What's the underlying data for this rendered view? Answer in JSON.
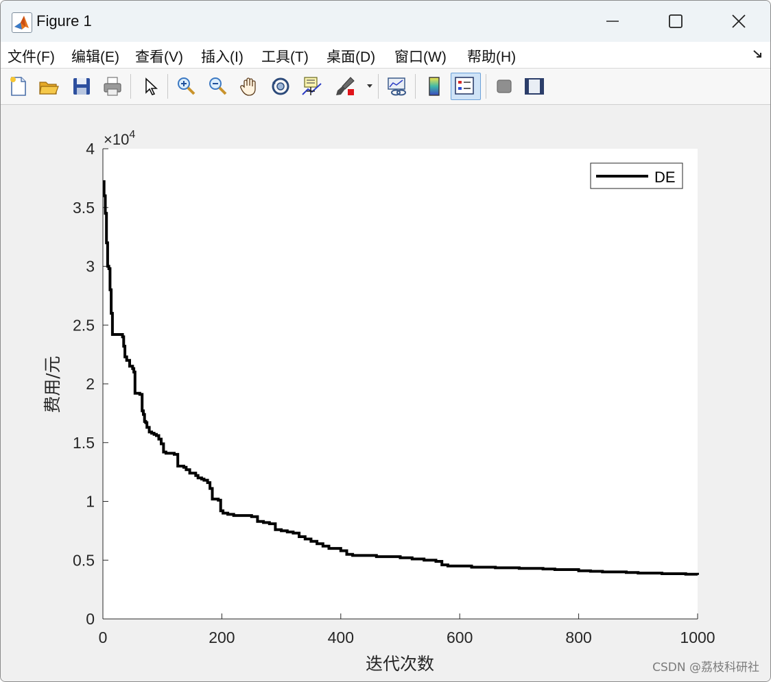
{
  "window": {
    "title": "Figure 1",
    "minimize_glyph": "—",
    "maximize_glyph": "□",
    "close_glyph": "✕"
  },
  "menu": {
    "items": [
      "文件(F)",
      "编辑(E)",
      "查看(V)",
      "插入(I)",
      "工具(T)",
      "桌面(D)",
      "窗口(W)",
      "帮助(H)"
    ]
  },
  "toolbar": {
    "icons": [
      "new-figure-icon",
      "open-file-icon",
      "save-icon",
      "print-icon",
      "pointer-icon",
      "zoom-in-icon",
      "zoom-out-icon",
      "pan-icon",
      "rotate-3d-icon",
      "data-cursor-icon",
      "brush-icon",
      "link-plot-icon",
      "colorbar-icon",
      "legend-icon",
      "hide-plot-tools-icon",
      "show-plot-tools-icon"
    ],
    "active": "legend-icon"
  },
  "chart_data": {
    "type": "line",
    "xlabel": "迭代次数",
    "ylabel": "费用/元",
    "xlim": [
      0,
      1000
    ],
    "ylim": [
      0,
      40000
    ],
    "x_ticks": [
      0,
      200,
      400,
      600,
      800,
      1000
    ],
    "x_tick_labels": [
      "0",
      "200",
      "400",
      "600",
      "800",
      "1000"
    ],
    "y_ticks": [
      0,
      5000,
      10000,
      15000,
      20000,
      25000,
      30000,
      35000,
      40000
    ],
    "y_tick_labels": [
      "0",
      "0.5",
      "1",
      "1.5",
      "2",
      "2.5",
      "3",
      "3.5",
      "4"
    ],
    "y_exponent_label": "×10",
    "y_exponent_power": "4",
    "grid": false,
    "legend_position": "top-right",
    "series": [
      {
        "name": "DE",
        "color": "#000000",
        "x": [
          0,
          2,
          4,
          6,
          8,
          10,
          12,
          14,
          16,
          20,
          25,
          30,
          33,
          35,
          37,
          40,
          45,
          50,
          52,
          54,
          56,
          58,
          62,
          66,
          68,
          70,
          72,
          74,
          78,
          82,
          86,
          90,
          94,
          98,
          102,
          106,
          110,
          114,
          120,
          126,
          130,
          136,
          140,
          146,
          150,
          156,
          160,
          166,
          170,
          176,
          180,
          184,
          188,
          194,
          198,
          202,
          210,
          220,
          240,
          250,
          260,
          270,
          280,
          290,
          300,
          310,
          320,
          330,
          340,
          350,
          360,
          370,
          380,
          400,
          410,
          420,
          440,
          460,
          480,
          500,
          520,
          540,
          560,
          570,
          580,
          600,
          620,
          640,
          660,
          680,
          700,
          720,
          740,
          760,
          780,
          800,
          820,
          840,
          860,
          880,
          900,
          920,
          940,
          960,
          980,
          1000
        ],
        "y": [
          37200,
          36000,
          34500,
          32000,
          30000,
          29800,
          28000,
          26000,
          24200,
          24200,
          24200,
          24200,
          24000,
          23200,
          22300,
          22000,
          21500,
          21300,
          21000,
          19200,
          19200,
          19200,
          19100,
          17700,
          17400,
          16800,
          16700,
          16300,
          15900,
          15800,
          15700,
          15600,
          15300,
          14900,
          14200,
          14100,
          14100,
          14100,
          14000,
          13000,
          13000,
          12900,
          12700,
          12400,
          12400,
          12200,
          12000,
          11900,
          11800,
          11600,
          11100,
          10200,
          10200,
          10100,
          9200,
          9000,
          8900,
          8800,
          8800,
          8700,
          8300,
          8200,
          8100,
          7600,
          7500,
          7400,
          7300,
          7000,
          6800,
          6600,
          6400,
          6200,
          6000,
          5800,
          5500,
          5400,
          5400,
          5300,
          5300,
          5200,
          5100,
          5000,
          4900,
          4600,
          4500,
          4500,
          4400,
          4400,
          4350,
          4350,
          4300,
          4300,
          4250,
          4200,
          4200,
          4100,
          4050,
          4000,
          4000,
          3950,
          3900,
          3900,
          3850,
          3850,
          3800,
          3750
        ]
      }
    ]
  },
  "watermark": "CSDN @荔枝科研社"
}
